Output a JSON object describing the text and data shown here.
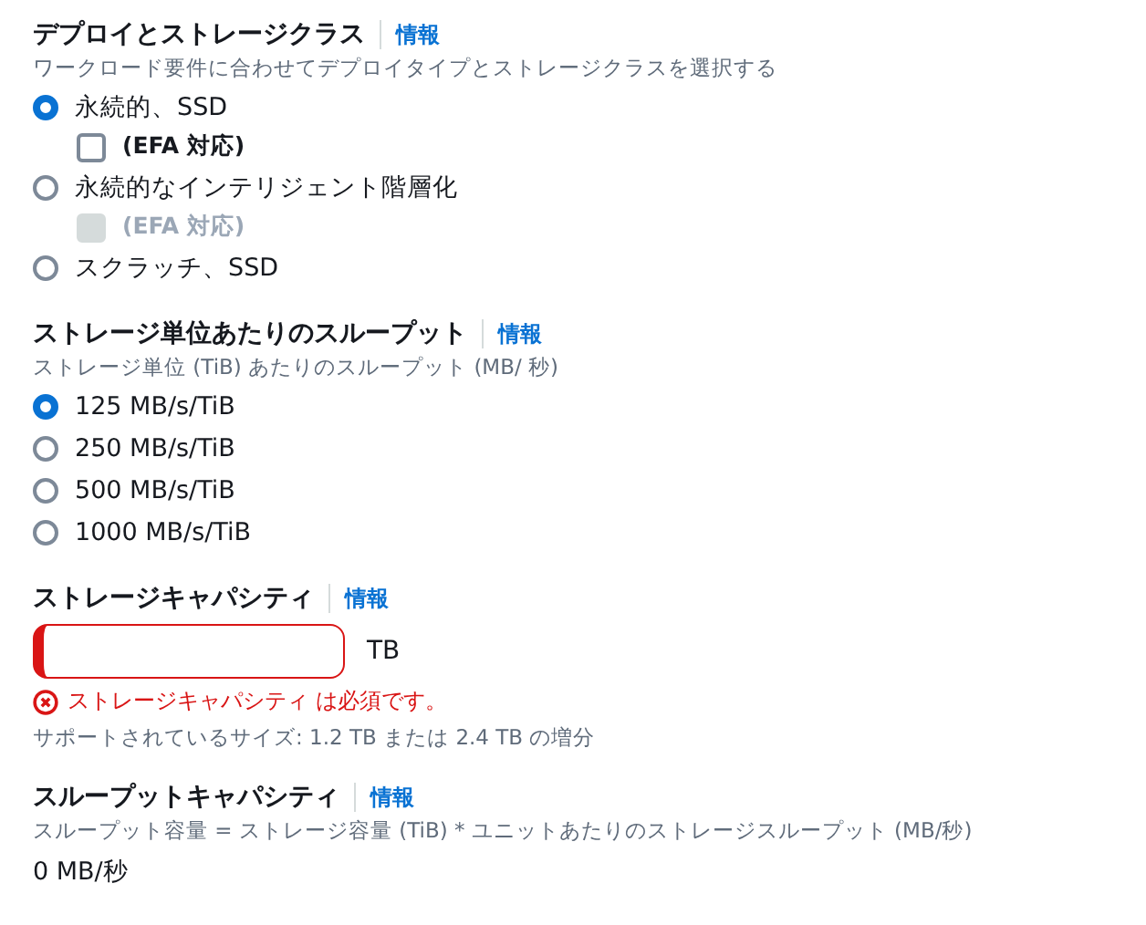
{
  "sections": [
    {
      "kind": "radio_group",
      "title": "デプロイとストレージクラス",
      "info": "情報",
      "description": "ワークロード要件に合わせてデプロイタイプとストレージクラスを選択する",
      "options": [
        {
          "label": "永続的、SSD",
          "selected": true,
          "checkbox": {
            "label": "(EFA 対応)",
            "checked": false,
            "disabled": false
          }
        },
        {
          "label": "永続的なインテリジェント階層化",
          "selected": false,
          "checkbox": {
            "label": "(EFA 対応)",
            "checked": false,
            "disabled": true
          }
        },
        {
          "label": "スクラッチ、SSD",
          "selected": false
        }
      ]
    },
    {
      "kind": "radio_group",
      "title": "ストレージ単位あたりのスループット",
      "info": "情報",
      "description": "ストレージ単位 (TiB) あたりのスループット (MB/ 秒)",
      "options": [
        {
          "label": "125 MB/s/TiB",
          "selected": true
        },
        {
          "label": "250 MB/s/TiB",
          "selected": false
        },
        {
          "label": "500 MB/s/TiB",
          "selected": false
        },
        {
          "label": "1000 MB/s/TiB",
          "selected": false
        }
      ]
    },
    {
      "kind": "capacity",
      "title": "ストレージキャパシティ",
      "info": "情報",
      "field": {
        "unit": "TB",
        "invalid": true
      },
      "error": "ストレージキャパシティ は必須です。",
      "constraint": "サポートされているサイズ: 1.2 TB または 2.4 TB の増分"
    },
    {
      "kind": "computed",
      "title": "スループットキャパシティ",
      "info": "情報",
      "description": "スループット容量 = ストレージ容量 (TiB) * ユニットあたりのストレージスループット (MB/秒)",
      "value": "0 MB/秒"
    }
  ]
}
